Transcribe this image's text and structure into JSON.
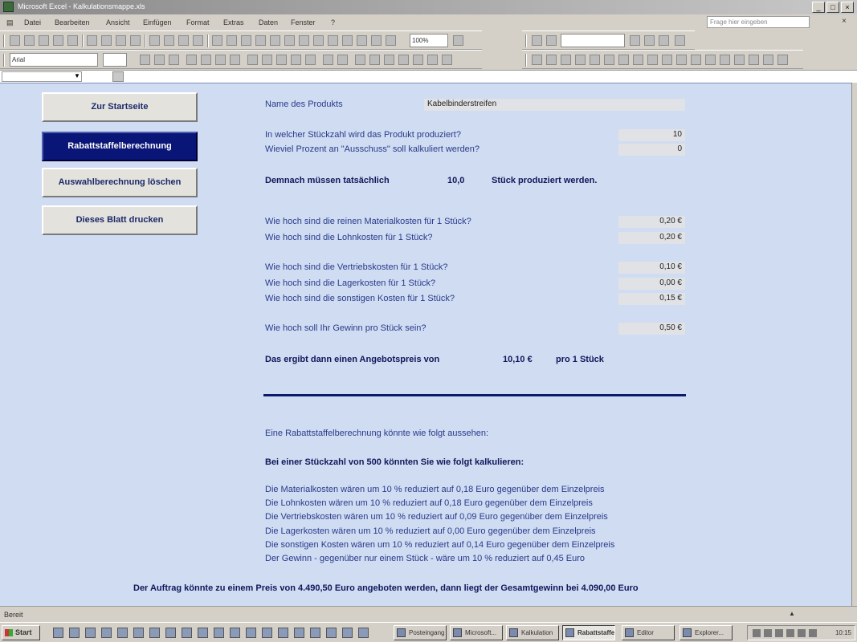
{
  "window": {
    "title": "Microsoft Excel - Kalkulationsmappe.xls",
    "win_buttons": [
      "_",
      "□",
      "×"
    ]
  },
  "menu": {
    "items": [
      "Datei",
      "Bearbeiten",
      "Ansicht",
      "Einfügen",
      "Format",
      "Extras",
      "Daten",
      "Fenster",
      "?"
    ],
    "help_placeholder": "Frage hier eingeben",
    "close_glyph": "×"
  },
  "toolbar": {
    "zoom": "100%",
    "font": "Arial",
    "icons": [
      "new-icon",
      "open-icon",
      "save-icon",
      "permission-icon",
      "email-icon",
      "search-icon",
      "print-icon",
      "print-preview-icon",
      "spelling-icon",
      "research-icon",
      "cut-icon",
      "copy-icon",
      "paste-icon",
      "format-painter-icon",
      "undo-icon",
      "redo-icon",
      "hyperlink-icon",
      "autosum-icon",
      "sort-asc-icon",
      "sort-desc-icon",
      "chart-wizard-icon",
      "drawing-icon",
      "help-icon"
    ]
  },
  "nav_buttons": [
    {
      "label": "Zur Startseite",
      "active": false
    },
    {
      "label": "Rabattstaffelberechnung",
      "active": true
    },
    {
      "label": "Auswahlberechnung löschen",
      "active": false
    },
    {
      "label": "Dieses Blatt drucken",
      "active": false
    }
  ],
  "form": {
    "product_label": "Name des Produkts",
    "product_value": "Kabelbinderstreifen",
    "qty_label": "In welcher Stückzahl wird das Produkt produziert?",
    "qty_value": "10",
    "scrap_label": "Wieviel Prozent an \"Ausschuss\" soll kalkuliert werden?",
    "scrap_value": "0",
    "result_text": "Demnach müssen tatsächlich",
    "result_value": "10,0",
    "result_unit": "Stück produziert werden.",
    "material_label": "Wie hoch sind die reinen Materialkosten für 1 Stück?",
    "material_value": "0,20 €",
    "wage_label": "Wie hoch sind die Lohnkosten für 1 Stück?",
    "wage_value": "0,20 €",
    "sales_label": "Wie hoch sind die Vertriebskosten für 1 Stück?",
    "sales_value": "0,10 €",
    "storage_label": "Wie hoch sind die Lagerkosten für 1 Stück?",
    "storage_value": "0,00 €",
    "other_label": "Wie hoch sind die sonstigen Kosten für 1 Stück?",
    "other_value": "0,15 €",
    "profit_label": "Wie hoch soll Ihr Gewinn pro Stück sein?",
    "profit_value": "0,50 €",
    "offer_text": "Das ergibt dann einen Angebotspreis von",
    "offer_value": "10,10 €",
    "offer_unit": "pro 1 Stück"
  },
  "discount": {
    "intro": "Eine Rabattstaffelberechnung könnte wie folgt aussehen:",
    "headline": "Bei einer Stückzahl von 500 könnten Sie wie folgt kalkulieren:",
    "lines": [
      "Die Materialkosten wären um 10 % reduziert auf 0,18 Euro gegenüber dem Einzelpreis",
      "Die Lohnkosten wären um 10 % reduziert auf 0,18 Euro gegenüber dem Einzelpreis",
      "Die Vertriebskosten wären um 10 % reduziert auf 0,09 Euro gegenüber dem Einzelpreis",
      "Die Lagerkosten wären um 10 % reduziert auf 0,00 Euro gegenüber dem Einzelpreis",
      "Die sonstigen Kosten wären um 10 % reduziert auf 0,14 Euro gegenüber dem Einzelpreis",
      "Der Gewinn - gegenüber nur einem Stück - wäre um 10 % reduziert auf 0,45 Euro"
    ],
    "summary": "Der Auftrag könnte zu einem Preis von 4.490,50 Euro angeboten werden, dann liegt der Gesamtgewinn bei 4.090,00 Euro"
  },
  "status": {
    "text": "Bereit",
    "arrow": "▲"
  },
  "taskbar": {
    "start_label": "Start",
    "tasks": [
      {
        "label": "Posteingang",
        "active": false
      },
      {
        "label": "Microsoft...",
        "active": false
      },
      {
        "label": "Kalkulation",
        "active": false
      },
      {
        "label": "Rabattstaffel",
        "active": true
      },
      {
        "label": "Editor",
        "active": false
      },
      {
        "label": "Explorer...",
        "active": false
      }
    ],
    "clock": "10:15"
  }
}
